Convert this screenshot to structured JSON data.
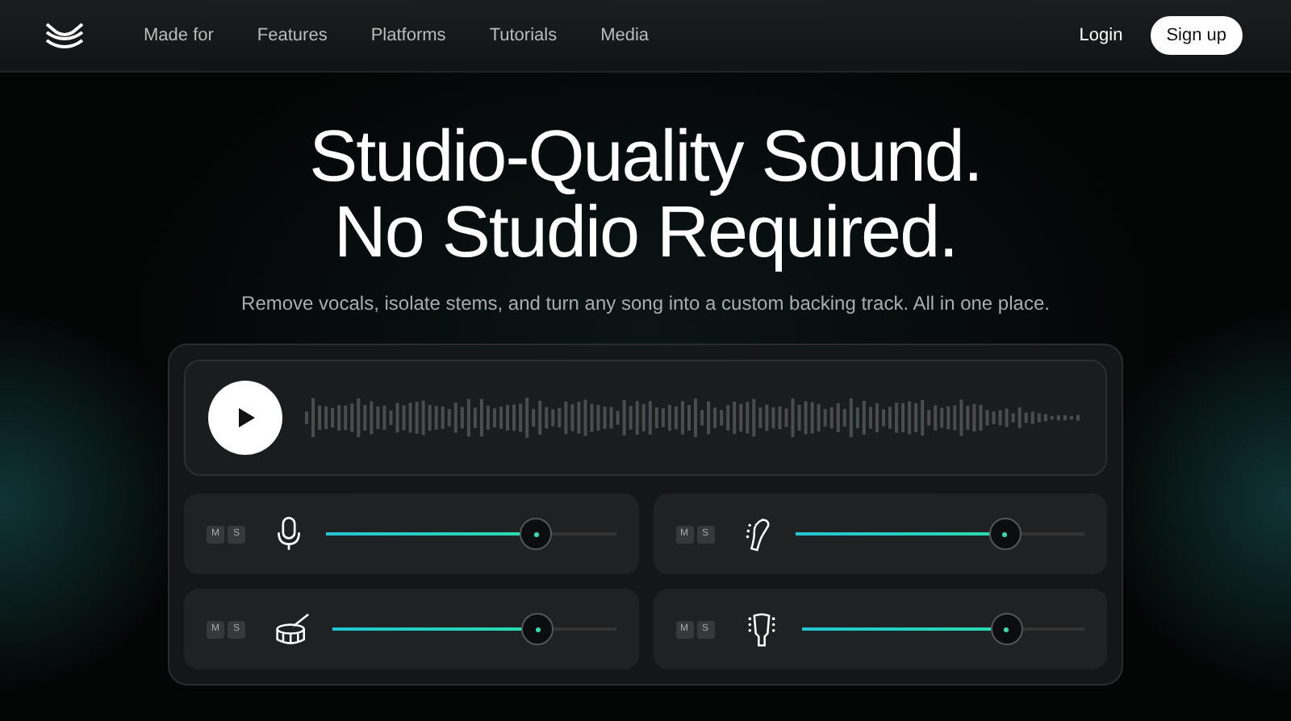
{
  "nav": {
    "links": [
      "Made for",
      "Features",
      "Platforms",
      "Tutorials",
      "Media"
    ],
    "login": "Login",
    "signup": "Sign up"
  },
  "hero": {
    "title_lines": [
      "Studio-Quality Sound.",
      "No Studio Required."
    ],
    "subtitle": "Remove vocals, isolate stems, and turn any song into a custom backing track. All in one place."
  },
  "player": {
    "stems": [
      {
        "kind": "mic",
        "mute": "M",
        "solo": "S",
        "level": 0.72
      },
      {
        "kind": "electric-guitar",
        "mute": "M",
        "solo": "S",
        "level": 0.72
      },
      {
        "kind": "drum",
        "mute": "M",
        "solo": "S",
        "level": 0.72
      },
      {
        "kind": "acoustic-guitar",
        "mute": "M",
        "solo": "S",
        "level": 0.72
      }
    ]
  }
}
